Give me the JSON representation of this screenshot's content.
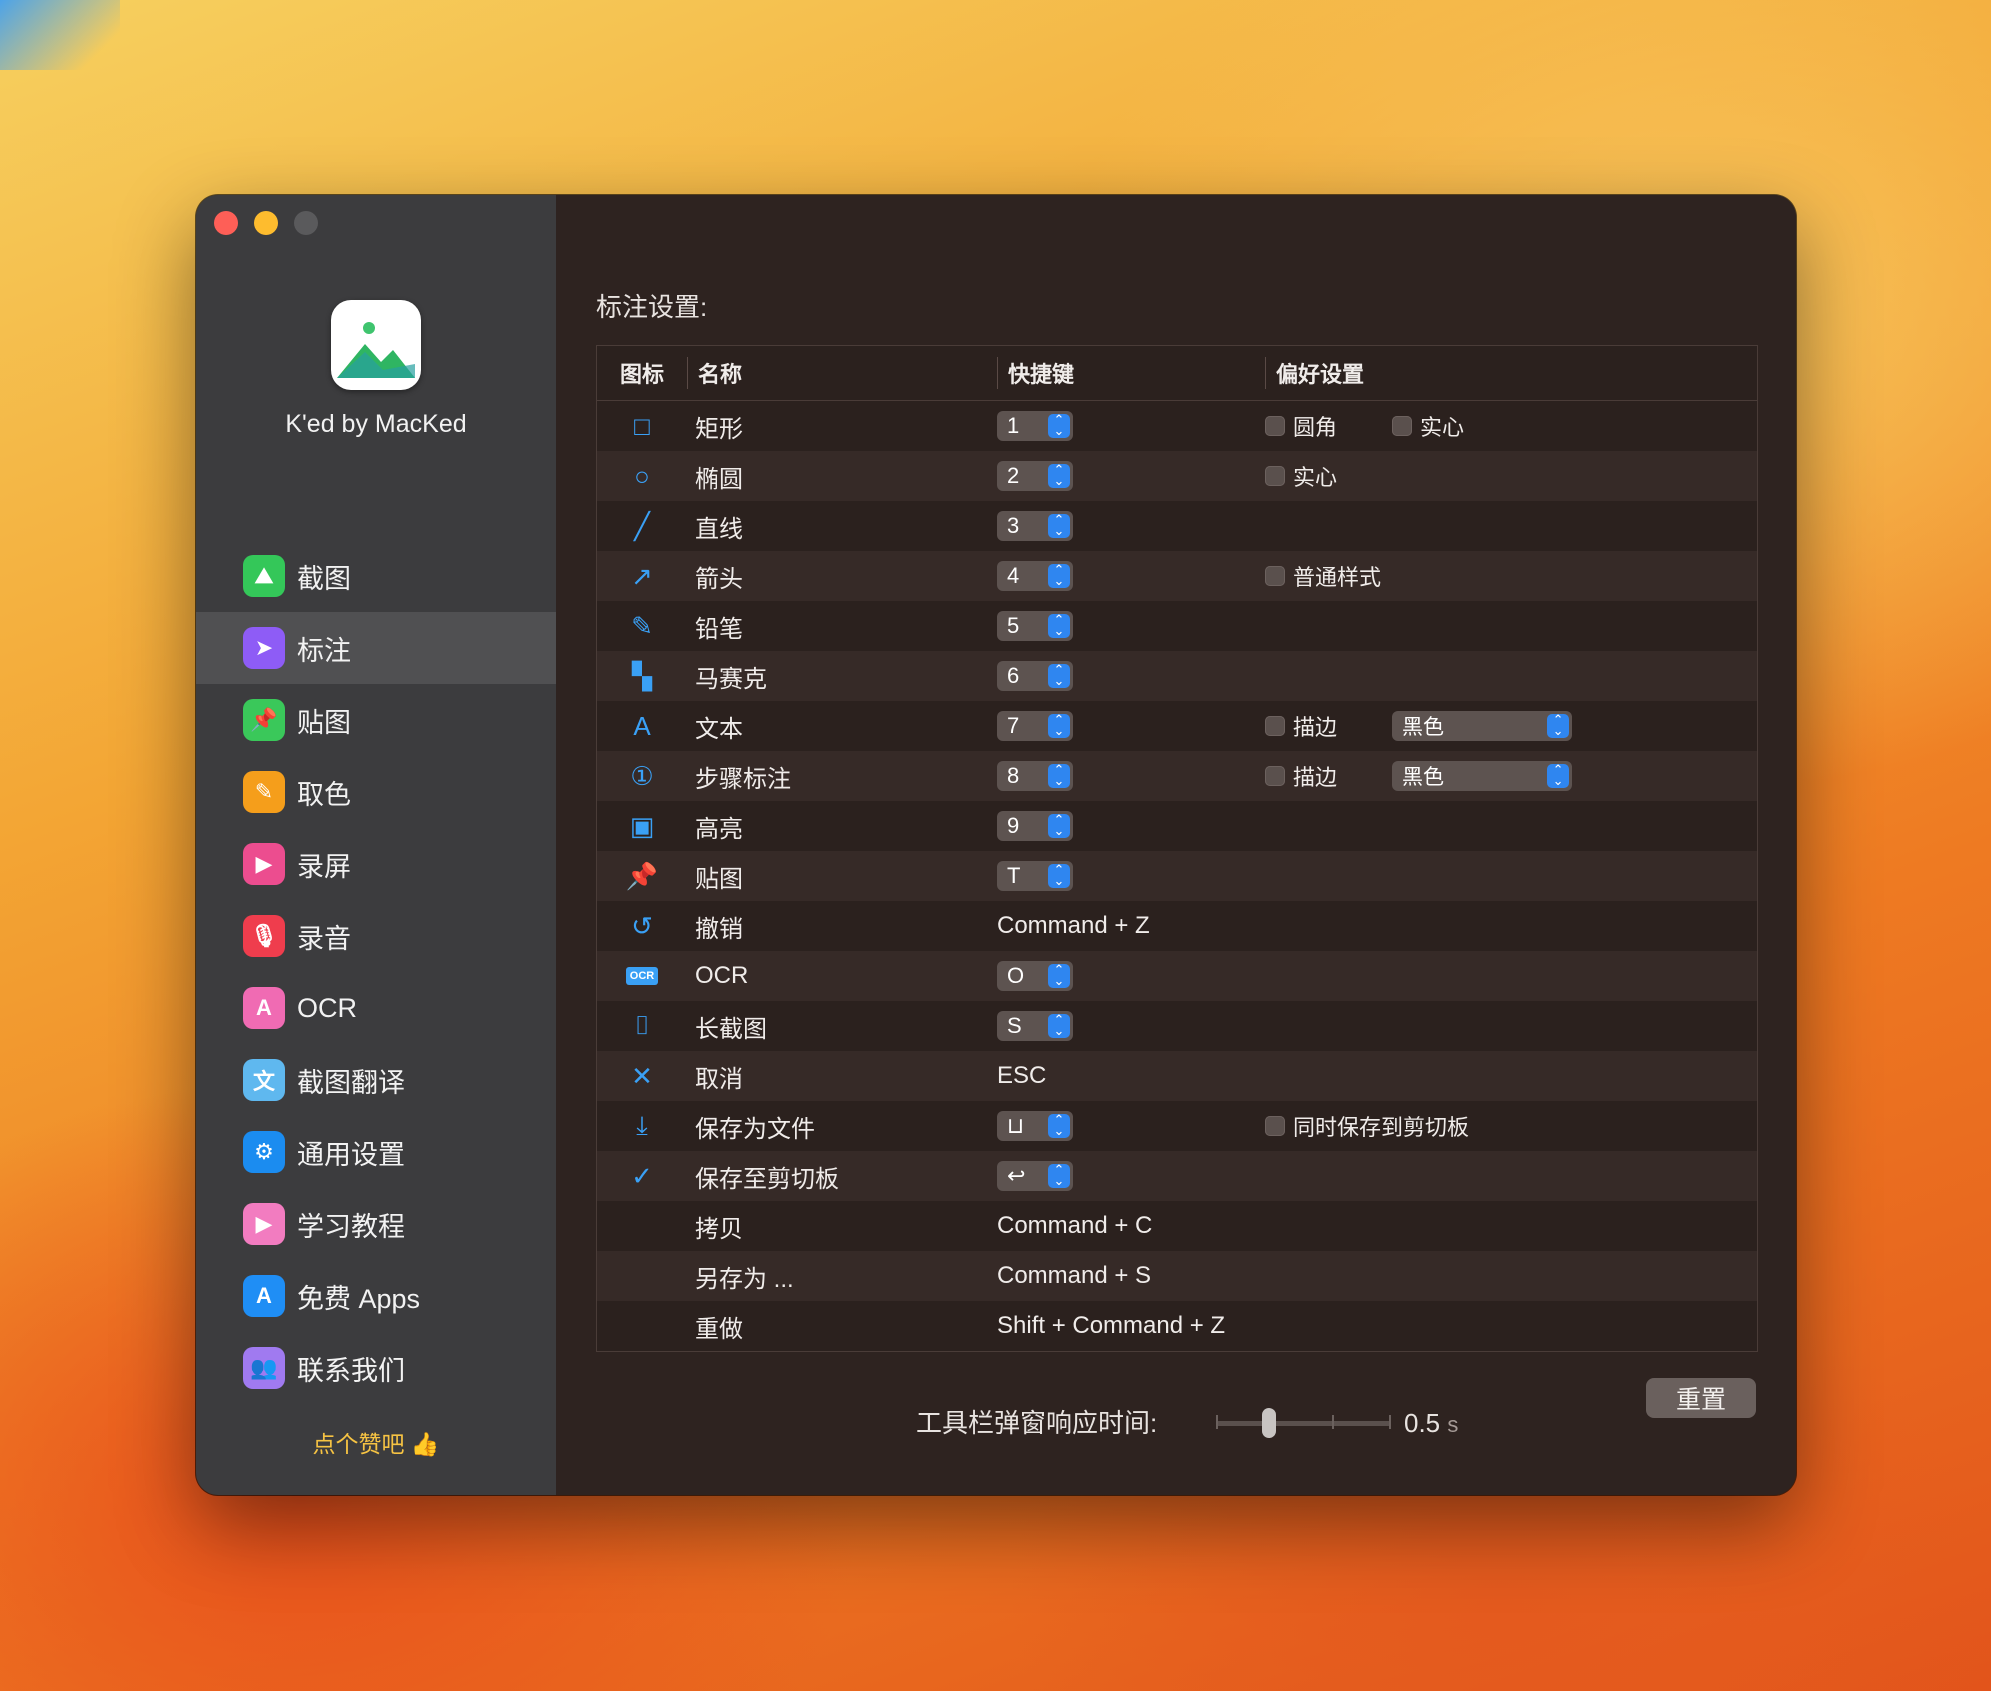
{
  "app": {
    "name": "K'ed by MacKed",
    "like_text": "点个赞吧"
  },
  "sidebar": {
    "items": [
      {
        "label": "截图",
        "icon": "image-icon",
        "color": "#34c759"
      },
      {
        "label": "标注",
        "icon": "cursor-icon",
        "color": "#8e5cf6",
        "active": true
      },
      {
        "label": "贴图",
        "icon": "pin-icon",
        "color": "#3ac85a"
      },
      {
        "label": "取色",
        "icon": "eyedropper-icon",
        "color": "#f59e1b"
      },
      {
        "label": "录屏",
        "icon": "video-icon",
        "color": "#ec4d8f"
      },
      {
        "label": "录音",
        "icon": "mic-icon",
        "color": "#ef3d4d"
      },
      {
        "label": "OCR",
        "icon": "ocr-text-icon",
        "color": "#f06bb3"
      },
      {
        "label": "截图翻译",
        "icon": "translate-icon",
        "color": "#5fb8ef"
      },
      {
        "label": "通用设置",
        "icon": "gear-icon",
        "color": "#1b8cf0"
      },
      {
        "label": "学习教程",
        "icon": "tutorial-icon",
        "color": "#f27cc0"
      },
      {
        "label": "免费 Apps",
        "icon": "appstore-icon",
        "color": "#1f8ef5"
      },
      {
        "label": "联系我们",
        "icon": "contacts-icon",
        "color": "#a07af0"
      }
    ]
  },
  "main": {
    "section_title": "标注设置:",
    "headers": {
      "icon": "图标",
      "name": "名称",
      "shortcut": "快捷键",
      "prefs": "偏好设置"
    },
    "rows": [
      {
        "icon": "□",
        "name": "矩形",
        "key": "1",
        "stepper": true,
        "prefs": [
          {
            "type": "check",
            "label": "圆角"
          },
          {
            "type": "check",
            "label": "实心"
          }
        ]
      },
      {
        "icon": "○",
        "name": "椭圆",
        "key": "2",
        "stepper": true,
        "prefs": [
          {
            "type": "check",
            "label": "实心"
          }
        ]
      },
      {
        "icon": "╱",
        "name": "直线",
        "key": "3",
        "stepper": true,
        "prefs": []
      },
      {
        "icon": "↗",
        "name": "箭头",
        "key": "4",
        "stepper": true,
        "prefs": [
          {
            "type": "check",
            "label": "普通样式"
          }
        ]
      },
      {
        "icon": "✎",
        "name": "铅笔",
        "key": "5",
        "stepper": true,
        "prefs": []
      },
      {
        "icon": "▚",
        "name": "马赛克",
        "key": "6",
        "stepper": true,
        "prefs": []
      },
      {
        "icon": "A",
        "name": "文本",
        "key": "7",
        "stepper": true,
        "prefs": [
          {
            "type": "check",
            "label": "描边"
          },
          {
            "type": "select",
            "label": "黑色"
          }
        ]
      },
      {
        "icon": "①",
        "name": "步骤标注",
        "key": "8",
        "stepper": true,
        "prefs": [
          {
            "type": "check",
            "label": "描边"
          },
          {
            "type": "select",
            "label": "黑色"
          }
        ]
      },
      {
        "icon": "▣",
        "name": "高亮",
        "key": "9",
        "stepper": true,
        "prefs": []
      },
      {
        "icon": "📌",
        "name": "贴图",
        "key": "T",
        "stepper": true,
        "prefs": []
      },
      {
        "icon": "↺",
        "name": "撤销",
        "key": "Command + Z",
        "stepper": false,
        "prefs": []
      },
      {
        "icon": "OCR",
        "name": "OCR",
        "key": "O",
        "stepper": true,
        "prefs": []
      },
      {
        "icon": "⌷",
        "name": "长截图",
        "key": "S",
        "stepper": true,
        "prefs": []
      },
      {
        "icon": "✕",
        "name": "取消",
        "key": "ESC",
        "stepper": false,
        "prefs": []
      },
      {
        "icon": "⤓",
        "name": "保存为文件",
        "key": "⊔",
        "stepper": true,
        "prefs": [
          {
            "type": "check",
            "label": "同时保存到剪切板"
          }
        ]
      },
      {
        "icon": "✓",
        "name": "保存至剪切板",
        "key": "↩",
        "stepper": true,
        "prefs": []
      },
      {
        "icon": "",
        "name": "拷贝",
        "key": "Command + C",
        "stepper": false,
        "prefs": []
      },
      {
        "icon": "",
        "name": "另存为 ...",
        "key": "Command + S",
        "stepper": false,
        "prefs": []
      },
      {
        "icon": "",
        "name": "重做",
        "key": "Shift + Command + Z",
        "stepper": false,
        "prefs": []
      }
    ],
    "slider": {
      "label": "工具栏弹窗响应时间:",
      "value": "0.5",
      "unit": "s",
      "level": 0.3
    },
    "reset_label": "重置"
  }
}
